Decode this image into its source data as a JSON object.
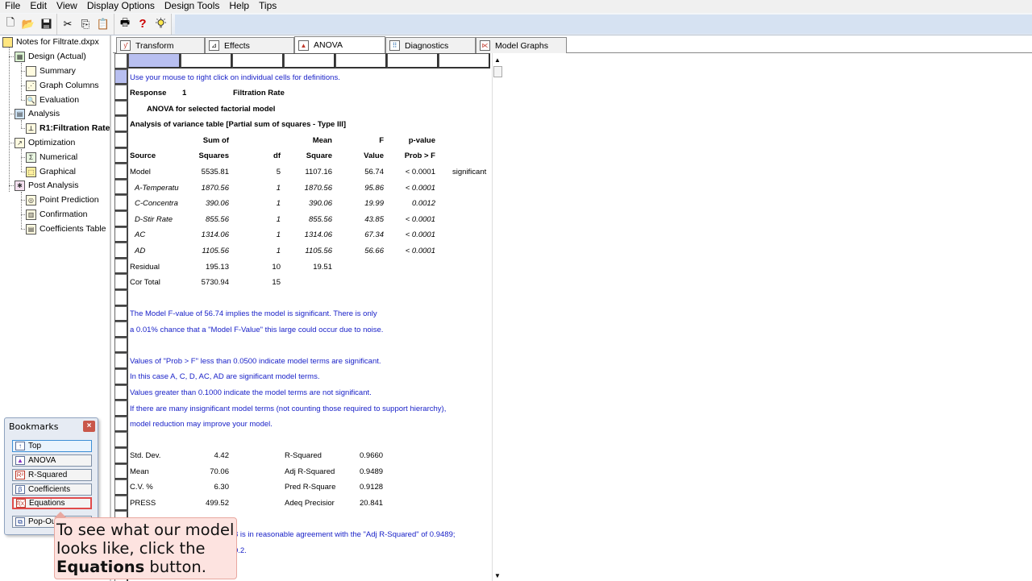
{
  "menu": [
    "File",
    "Edit",
    "View",
    "Display Options",
    "Design Tools",
    "Help",
    "Tips"
  ],
  "toolbar": {
    "icons": [
      "new-file-icon",
      "open-folder-icon",
      "save-icon",
      "cut-icon",
      "copy-icon",
      "paste-icon",
      "print-icon",
      "help-icon",
      "tip-bulb-icon"
    ]
  },
  "tree": {
    "root": "Notes for Filtrate.dxpx",
    "design": "Design (Actual)",
    "summary": "Summary",
    "graph_columns": "Graph Columns",
    "evaluation": "Evaluation",
    "analysis": "Analysis",
    "r1": "R1:Filtration Rate (",
    "optimization": "Optimization",
    "numerical": "Numerical",
    "graphical": "Graphical",
    "post_analysis": "Post Analysis",
    "point_prediction": "Point Prediction",
    "confirmation": "Confirmation",
    "coefficients_table": "Coefficients Table"
  },
  "bookmarks": {
    "title": "Bookmarks",
    "items": [
      "Top",
      "ANOVA",
      "R-Squared",
      "Coefficients",
      "Equations",
      "Pop-Ou"
    ]
  },
  "tabs": [
    "Transform",
    "Effects",
    "ANOVA",
    "Diagnostics",
    "Model Graphs"
  ],
  "report": {
    "hint": "Use your mouse to right click on individual cells for definitions.",
    "response_label": "Response",
    "response_num": "1",
    "response_name": "Filtration Rate",
    "model_title": "ANOVA for selected factorial model",
    "table_title": "Analysis of variance table [Partial sum of squares - Type III]",
    "hdr1": {
      "ss": "Sum of",
      "mean": "Mean",
      "f": "F",
      "p": "p-value"
    },
    "hdr2": {
      "source": "Source",
      "ss": "Squares",
      "df": "df",
      "mean": "Square",
      "f": "Value",
      "p": "Prob > F"
    },
    "rows": [
      {
        "source": "Model",
        "ss": "5535.81",
        "df": "5",
        "ms": "1107.16",
        "f": "56.74",
        "p": "< 0.0001",
        "note": "significant"
      },
      {
        "source": "A-Temperatu",
        "ss": "1870.56",
        "df": "1",
        "ms": "1870.56",
        "f": "95.86",
        "p": "< 0.0001",
        "note": ""
      },
      {
        "source": "C-Concentra",
        "ss": "390.06",
        "df": "1",
        "ms": "390.06",
        "f": "19.99",
        "p": "0.0012",
        "note": ""
      },
      {
        "source": "D-Stir Rate",
        "ss": "855.56",
        "df": "1",
        "ms": "855.56",
        "f": "43.85",
        "p": "< 0.0001",
        "note": ""
      },
      {
        "source": "AC",
        "ss": "1314.06",
        "df": "1",
        "ms": "1314.06",
        "f": "67.34",
        "p": "< 0.0001",
        "note": ""
      },
      {
        "source": "AD",
        "ss": "1105.56",
        "df": "1",
        "ms": "1105.56",
        "f": "56.66",
        "p": "< 0.0001",
        "note": ""
      },
      {
        "source": "Residual",
        "ss": "195.13",
        "df": "10",
        "ms": "19.51",
        "f": "",
        "p": "",
        "note": ""
      },
      {
        "source": "Cor Total",
        "ss": "5730.94",
        "df": "15",
        "ms": "",
        "f": "",
        "p": "",
        "note": ""
      }
    ],
    "note1": "The Model F-value of 56.74 implies the model is significant.  There is only",
    "note2": "a 0.01% chance that a \"Model F-Value\" this large could occur due to noise.",
    "note3": "Values of \"Prob > F\" less than 0.0500 indicate model terms are significant.",
    "note4": "In this case A, C, D, AC, AD are significant model terms.",
    "note5": "Values greater than 0.1000 indicate the model terms are not significant.",
    "note6": "If there are many insignificant model terms (not counting those required to support hierarchy),",
    "note7": "model reduction may improve your model.",
    "fit": [
      {
        "l1": "Std. Dev.",
        "v1": "4.42",
        "l2": "R-Squared",
        "v2": "0.9660"
      },
      {
        "l1": "Mean",
        "v1": "70.06",
        "l2": "Adj R-Squared",
        "v2": "0.9489"
      },
      {
        "l1": "C.V. %",
        "v1": "6.30",
        "l2": "Pred R-Square",
        "v2": "0.9128"
      },
      {
        "l1": "PRESS",
        "v1": "499.52",
        "l2": "Adeq Precisior",
        "v2": "20.841"
      }
    ],
    "note8_partial": "8 is in reasonable agreement with the \"Adj R-Squared\" of 0.9489;",
    "note9_partial": "0.2."
  },
  "callout": {
    "line1": "To see what our model",
    "line2": "looks like, click the",
    "bold": "Equations",
    "rest": " button."
  }
}
